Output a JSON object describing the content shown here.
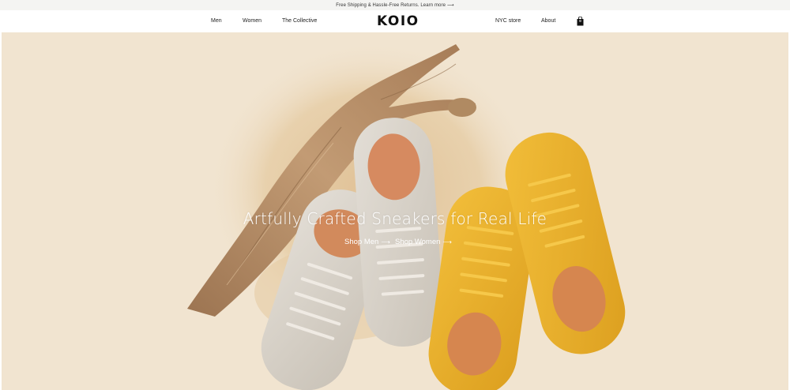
{
  "announcement": {
    "text": "Free Shipping & Hassle-Free Returns. Learn more",
    "arrow": "⟶"
  },
  "nav": {
    "left_links": [
      "Men",
      "Women",
      "The Collective"
    ],
    "logo": "KOIO",
    "right_links": [
      "NYC store",
      "About"
    ],
    "cart_icon": "shopping-bag-icon",
    "cart_count": "0"
  },
  "hero": {
    "title": "Artfully Crafted Sneakers for Real Life",
    "ctas": [
      {
        "label": "Shop Men",
        "arrow": "⟶"
      },
      {
        "label": "Shop Women",
        "arrow": "⟶"
      }
    ]
  },
  "colors": {
    "background": "#f1e4d0",
    "sand": "#e3c7a0",
    "driftwood": "#b58b62",
    "grey_sneaker": "#d8d2c8",
    "yellow_sneaker": "#eab32d",
    "lining": "#d68a60"
  }
}
